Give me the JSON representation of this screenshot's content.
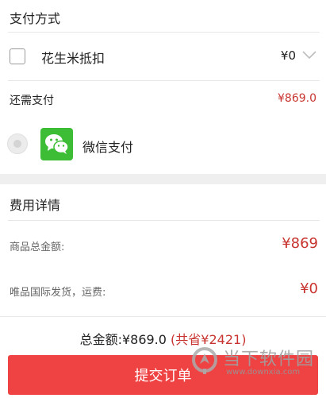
{
  "payment": {
    "title": "支付方式",
    "peanut": {
      "label": "花生米抵扣",
      "value": "¥0"
    },
    "remaining": {
      "label": "还需支付",
      "value": "¥869.0"
    },
    "wechat": {
      "label": "微信支付"
    }
  },
  "fees": {
    "title": "费用详情",
    "goods_total": {
      "label": "商品总金额:",
      "value": "¥869"
    },
    "shipping": {
      "label": "唯品国际发货，运费:",
      "value": "¥0"
    }
  },
  "footer": {
    "total_text": "总金额:¥869.0",
    "saved_text": "(共省¥2421)",
    "submit_label": "提交订单"
  },
  "watermark": {
    "name": "当下软件园",
    "url": "www.downxia.com"
  },
  "colors": {
    "accent_red": "#ef4243",
    "price_red": "#c8342f",
    "wechat_green": "#3dbd36"
  }
}
